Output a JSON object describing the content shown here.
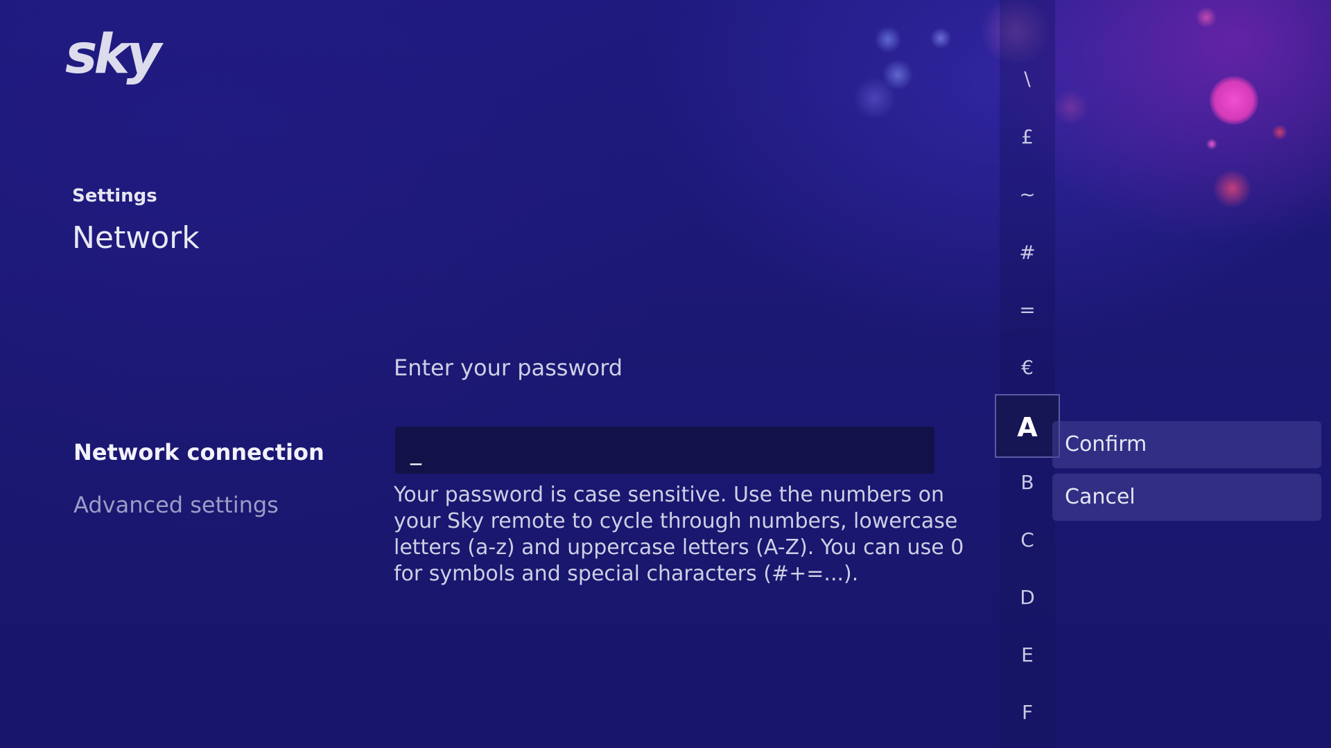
{
  "logo": {
    "text": "sky"
  },
  "header": {
    "breadcrumb": "Settings",
    "title": "Network"
  },
  "menu": {
    "items": [
      {
        "label": "Network connection",
        "active": true
      },
      {
        "label": "Advanced settings",
        "active": false
      }
    ]
  },
  "password": {
    "prompt": "Enter your password",
    "value": "_",
    "help": "Your password is case sensitive. Use the numbers on your Sky remote to cycle through numbers, lowercase letters (a-z) and uppercase letters (A-Z). You can use 0 for symbols and special characters (#+=...)."
  },
  "keyboard": {
    "characters": [
      "\\",
      "£",
      "~",
      "#",
      "=",
      "€",
      "A",
      "B",
      "C",
      "D",
      "E",
      "F"
    ],
    "selected": "A"
  },
  "actions": {
    "confirm_label": "Confirm",
    "cancel_label": "Cancel"
  },
  "colors": {
    "background": "#1b1873",
    "field": "#131248",
    "button": "#46429a",
    "accent_glow": "#d63cc8"
  }
}
